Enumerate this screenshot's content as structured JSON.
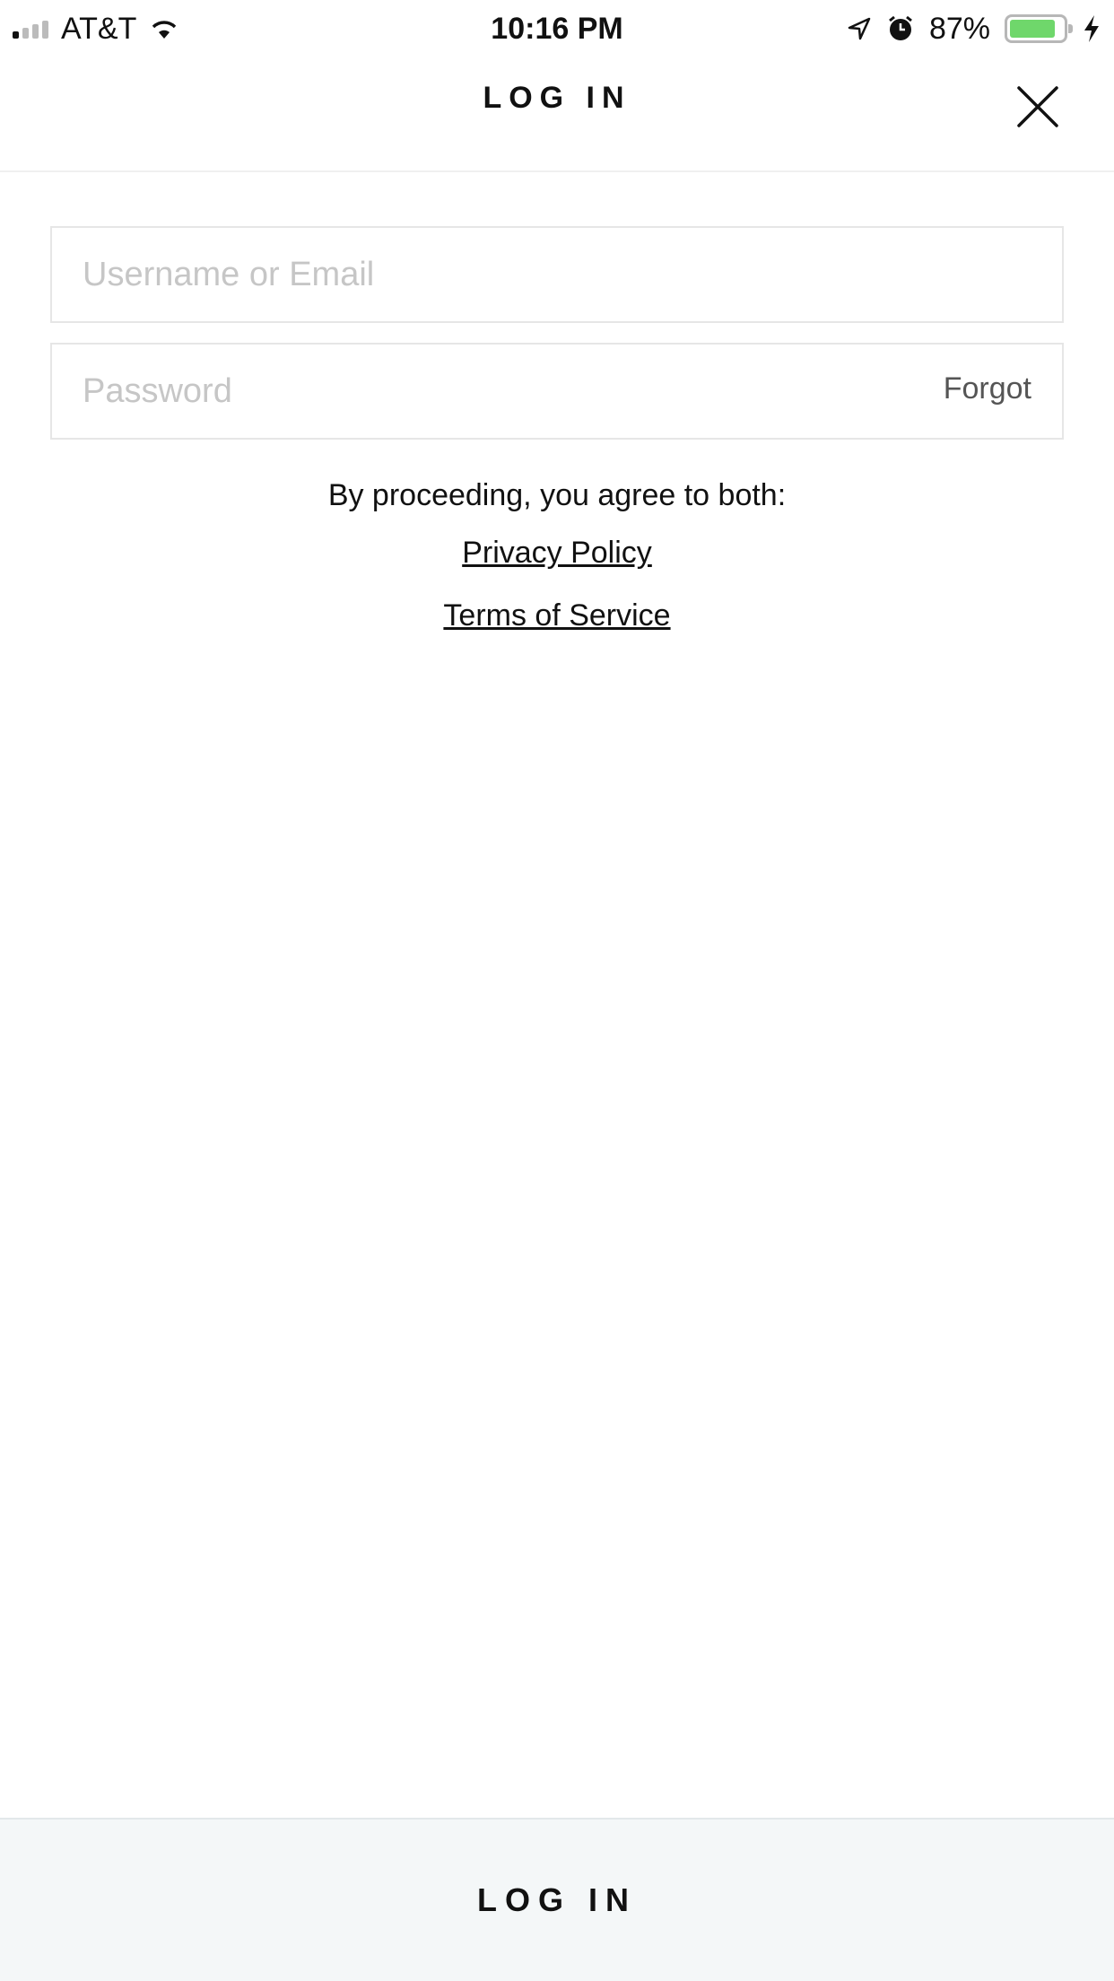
{
  "status_bar": {
    "carrier": "AT&T",
    "time": "10:16 PM",
    "battery_percent": "87%",
    "battery_level": 0.87,
    "icons": [
      "signal-icon",
      "wifi-icon",
      "location-arrow-icon",
      "alarm-icon",
      "battery-icon",
      "charging-bolt-icon"
    ]
  },
  "nav": {
    "title": "LOG IN",
    "close_icon": "close-icon"
  },
  "form": {
    "username_placeholder": "Username or Email",
    "username_value": "",
    "password_placeholder": "Password",
    "password_value": "",
    "forgot_label": "Forgot"
  },
  "terms": {
    "text": "By proceeding, you agree to both:",
    "privacy_label": "Privacy Policy",
    "tos_label": "Terms of Service"
  },
  "footer": {
    "login_label": "LOG IN"
  },
  "colors": {
    "button_bg": "#f4f7f8",
    "battery_fill": "#6fd76b",
    "placeholder": "#c6c6c6"
  }
}
